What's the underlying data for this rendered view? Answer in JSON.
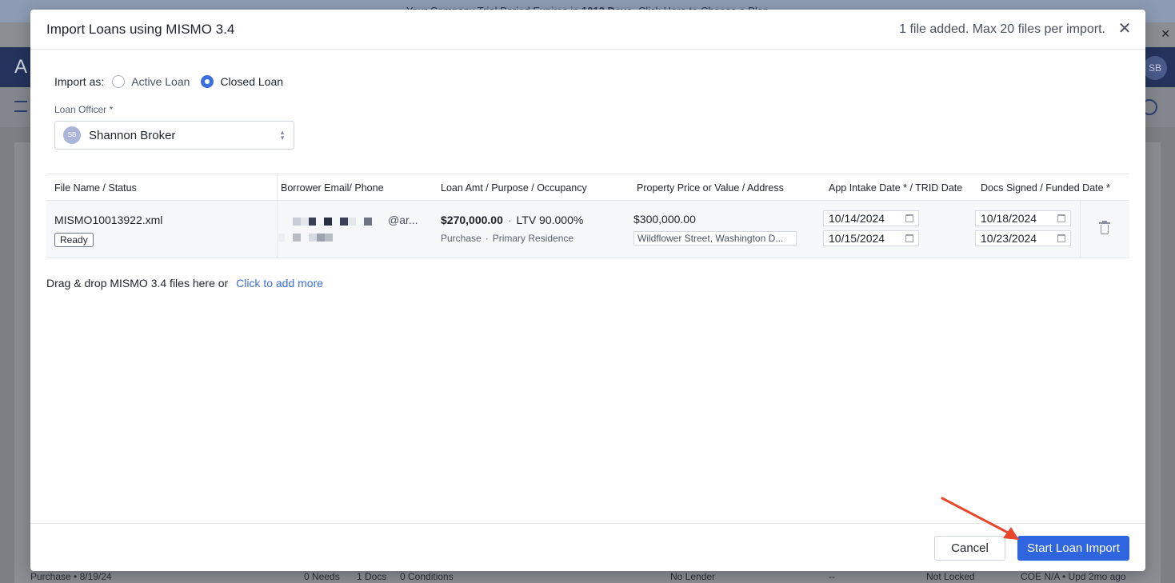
{
  "background": {
    "banner_prefix": "Your Company Trial Period Expires in ",
    "banner_days": "1013 Days",
    "banner_suffix": ". Click Here to Choose a Plan",
    "nav_letter": "A",
    "avatar_initials": "SB",
    "footer": {
      "purpose": "Purchase • 8/19/24",
      "needs": "0 Needs",
      "docs": "1 Docs",
      "conditions": "0 Conditions",
      "lender": "No Lender",
      "dash": "--",
      "lock": "Not Locked",
      "coe": "COE N/A • Upd 2mo ago"
    }
  },
  "modal": {
    "title": "Import Loans using MISMO 3.4",
    "file_count": "1 file added. Max 20 files per import.",
    "import_as_label": "Import as:",
    "options": [
      {
        "label": "Active Loan",
        "checked": false
      },
      {
        "label": "Closed Loan",
        "checked": true
      }
    ],
    "loan_officer": {
      "label": "Loan Officer *",
      "initials": "SB",
      "name": "Shannon Broker"
    },
    "table": {
      "headers": [
        "File Name / Status",
        "Borrower Email/ Phone",
        "Loan Amt / Purpose / Occupancy",
        "Property Price or Value / Address",
        "App Intake Date * / TRID Date",
        "Docs Signed / Funded Date *"
      ],
      "rows": [
        {
          "file_name": "MISMO10013922.xml",
          "status": "Ready",
          "email_tail": "@ar...",
          "loan_amount": "$270,000.00",
          "ltv": "LTV 90.000%",
          "purpose": "Purchase",
          "occupancy": "Primary Residence",
          "property_price": "$300,000.00",
          "address": "Wildflower Street, Washington D...",
          "app_intake_date": "10/14/2024",
          "trid_date": "10/15/2024",
          "docs_signed_date": "10/18/2024",
          "funded_date": "10/23/2024"
        }
      ]
    },
    "drop_text": "Drag & drop MISMO 3.4 files here or",
    "drop_link": "Click to add more",
    "cancel_label": "Cancel",
    "start_label": "Start Loan Import",
    "colors": {
      "primary": "#2f66e0",
      "arrow": "#e8472b",
      "nav": "#24335c"
    }
  }
}
